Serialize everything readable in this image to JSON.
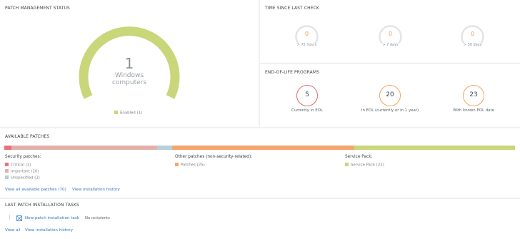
{
  "patch_status": {
    "title": "PATCH MANAGEMENT STATUS",
    "count": "1",
    "label_line1": "Windows",
    "label_line2": "computers",
    "legend": "Enabled (1)",
    "color": "#c9d77a"
  },
  "time_since": {
    "title": "TIME SINCE LAST CHECK",
    "gauges": [
      {
        "value": "0",
        "label": "> 72 hours"
      },
      {
        "value": "0",
        "label": "> 7 days"
      },
      {
        "value": "0",
        "label": "> 30 days"
      }
    ]
  },
  "eol": {
    "title": "END-OF-LIFE PROGRAMS",
    "items": [
      {
        "value": "5",
        "label": "Currently in EOL",
        "color": "#e06a70"
      },
      {
        "value": "20",
        "label": "In EOL (currently or in 1 year)",
        "color": "#f2a65c"
      },
      {
        "value": "23",
        "label": "With known EOL date",
        "color": "#f2a65c"
      }
    ]
  },
  "available": {
    "title": "AVAILABLE PATCHES",
    "bar": [
      {
        "name": "Critical",
        "value": 1,
        "color": "#e8737c"
      },
      {
        "name": "Important",
        "value": 20,
        "color": "#e3b0a8"
      },
      {
        "name": "Unspecified",
        "value": 2,
        "color": "#b7cfd8"
      },
      {
        "name": "Patches",
        "value": 25,
        "color": "#f4a66c"
      },
      {
        "name": "Service Pack",
        "value": 22,
        "color": "#c9d77a"
      }
    ],
    "security_title": "Security patches:",
    "security_items": [
      "Critical (1)",
      "Important (20)",
      "Unspecified (2)"
    ],
    "other_title": "Other patches (non-security-related):",
    "other_items": [
      "Patches (25)"
    ],
    "sp_title": "Service Pack:",
    "sp_items": [
      "Service Pack (22)"
    ],
    "link_view_all": "View all available patches (70)",
    "link_history": "View installation history"
  },
  "tasks": {
    "title": "LAST PATCH INSTALLATION TASKS",
    "task_name": "New patch installation task",
    "task_recipients": "No recipients",
    "link_view_all": "View all",
    "link_history": "View installation history"
  }
}
